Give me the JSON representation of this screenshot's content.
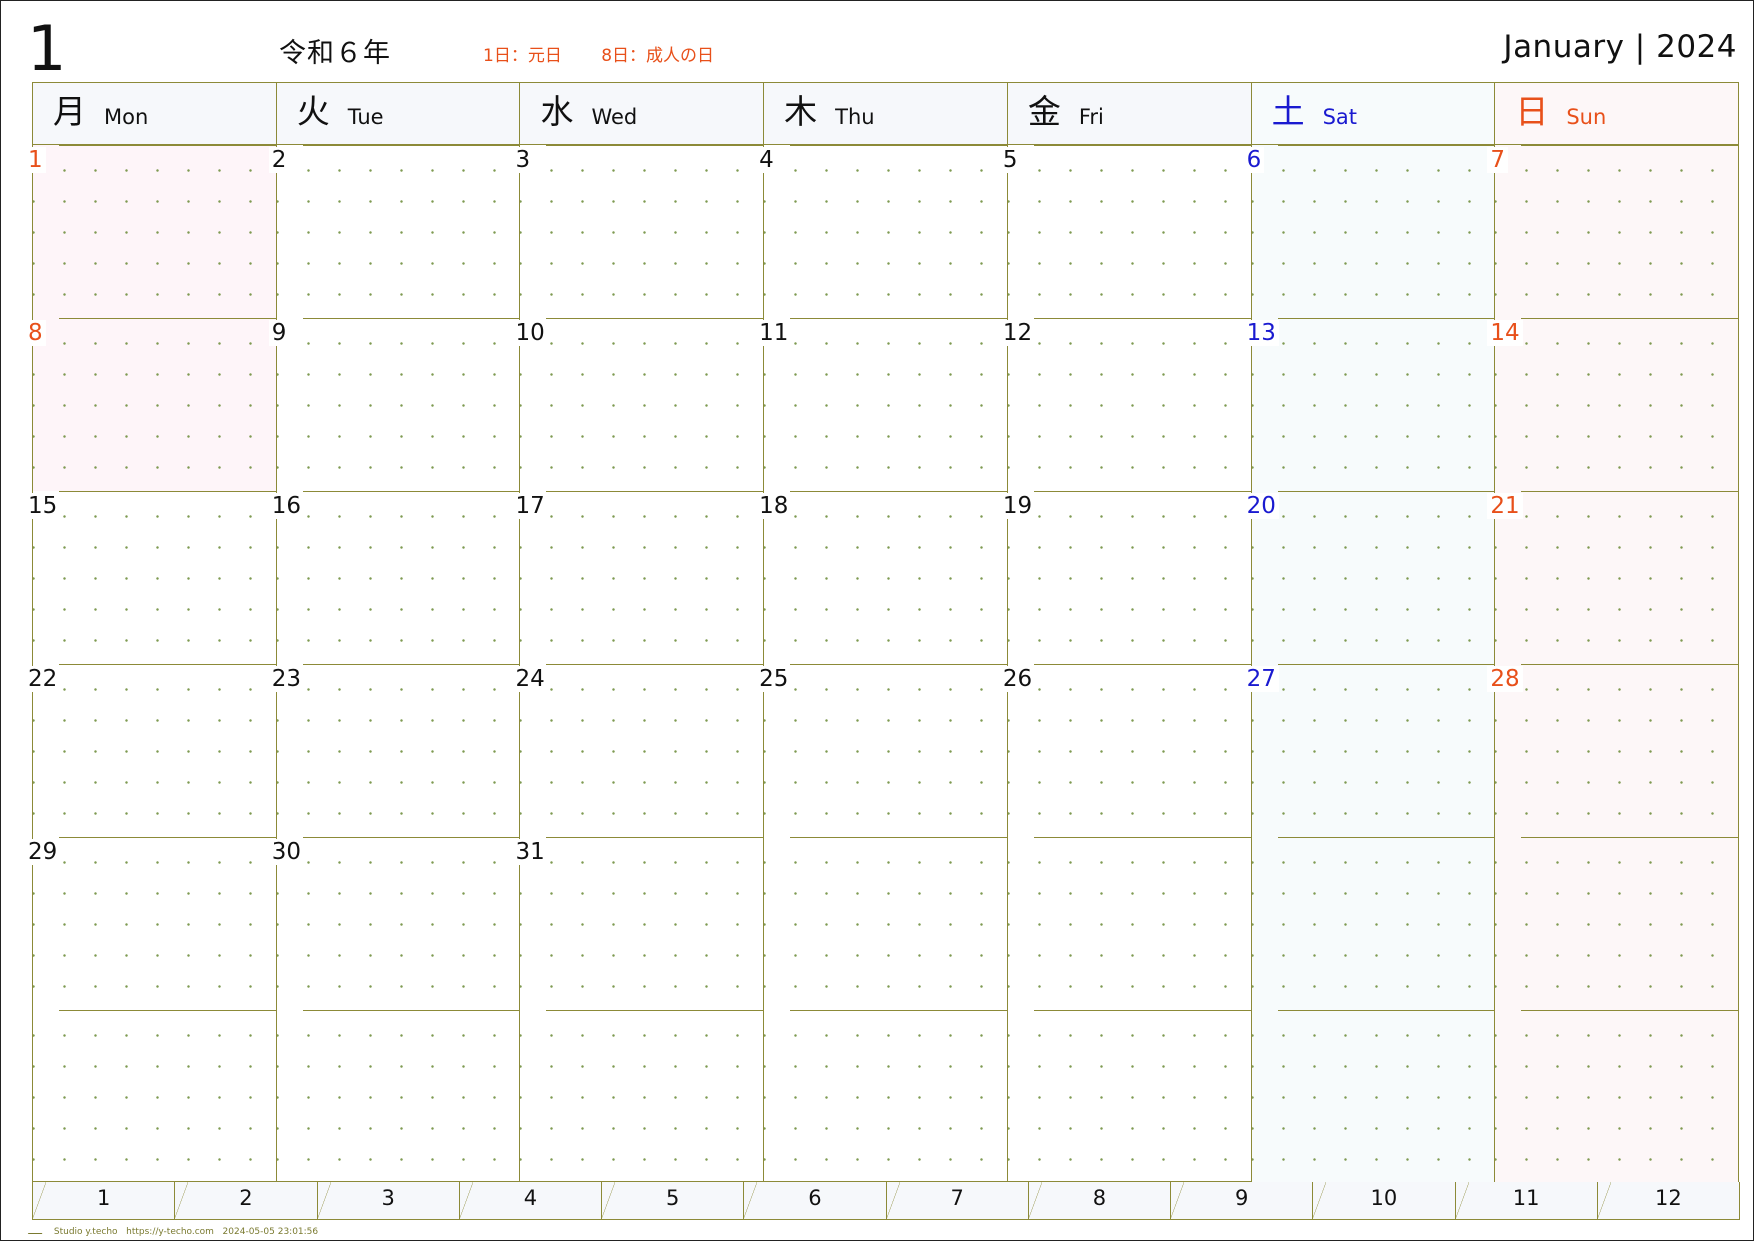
{
  "header": {
    "month_number": "1",
    "era_year": "令和６年",
    "holidays": [
      "1日：元日",
      "8日：成人の日"
    ],
    "month_year": "January | 2024"
  },
  "weekdays": [
    {
      "jp": "月",
      "en": "Mon"
    },
    {
      "jp": "火",
      "en": "Tue"
    },
    {
      "jp": "水",
      "en": "Wed"
    },
    {
      "jp": "木",
      "en": "Thu"
    },
    {
      "jp": "金",
      "en": "Fri"
    },
    {
      "jp": "土",
      "en": "Sat"
    },
    {
      "jp": "日",
      "en": "Sun"
    }
  ],
  "weeks": [
    [
      "1",
      "2",
      "3",
      "4",
      "5",
      "6",
      "7"
    ],
    [
      "8",
      "9",
      "10",
      "11",
      "12",
      "13",
      "14"
    ],
    [
      "15",
      "16",
      "17",
      "18",
      "19",
      "20",
      "21"
    ],
    [
      "22",
      "23",
      "24",
      "25",
      "26",
      "27",
      "28"
    ],
    [
      "29",
      "30",
      "31",
      "",
      "",
      "",
      ""
    ],
    [
      "",
      "",
      "",
      "",
      "",
      "",
      ""
    ]
  ],
  "holiday_days": [
    "1",
    "8"
  ],
  "month_tabs": [
    "1",
    "2",
    "3",
    "4",
    "5",
    "6",
    "7",
    "8",
    "9",
    "10",
    "11",
    "12"
  ],
  "footer": {
    "brand": "Studio y.techo",
    "url": "https://y-techo.com",
    "timestamp": "2024-05-05 23:01:56"
  },
  "colors": {
    "holiday_red": "#e8501a",
    "saturday_blue": "#1a1ad0",
    "grid_line": "#8c8a38"
  }
}
